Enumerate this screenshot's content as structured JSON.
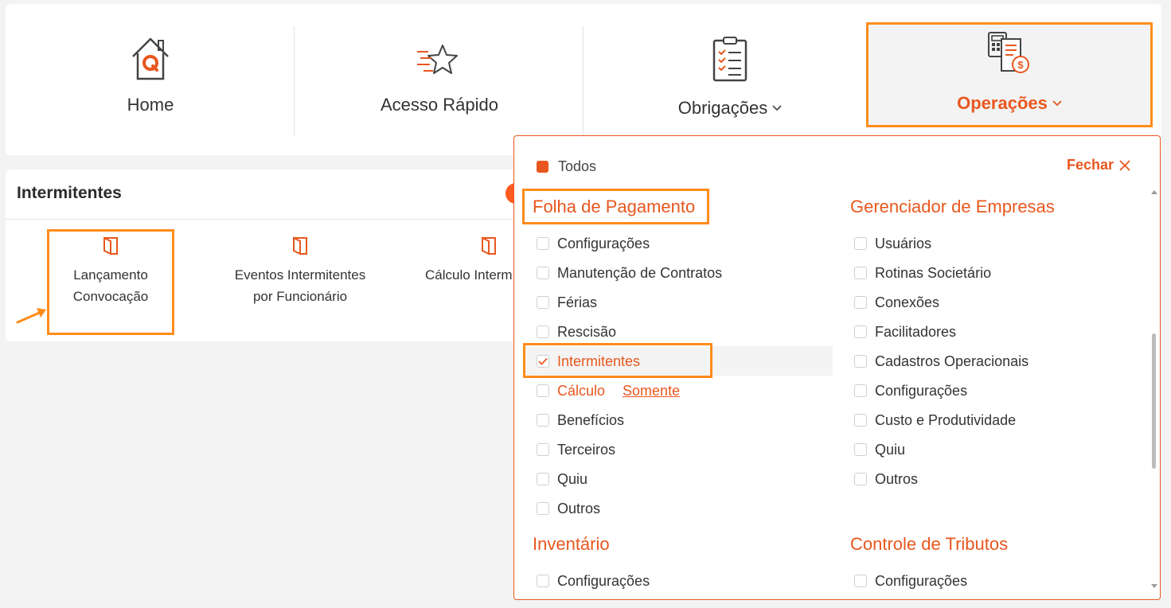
{
  "nav": {
    "home_label": "Home",
    "acesso_label": "Acesso Rápido",
    "obrigacoes_label": "Obrigações",
    "operacoes_label": "Operações",
    "chevron": "⌄"
  },
  "card": {
    "title": "Intermitentes",
    "tiles": [
      {
        "line1": "Lançamento",
        "line2": "Convocação"
      },
      {
        "line1": "Eventos Intermitentes",
        "line2": "por Funcionário"
      },
      {
        "line1": "Cálculo Interm",
        "line2": ""
      }
    ]
  },
  "dropdown": {
    "todos_label": "Todos",
    "fechar_label": "Fechar",
    "sections": {
      "folha": {
        "title": "Folha de Pagamento",
        "items": [
          "Configurações",
          "Manutenção de Contratos",
          "Férias",
          "Rescisão",
          "Intermitentes",
          "Cálculo",
          "Benefícios",
          "Terceiros",
          "Quiu",
          "Outros"
        ],
        "somente_label": "Somente"
      },
      "gerenciador": {
        "title": "Gerenciador de Empresas",
        "items": [
          "Usuários",
          "Rotinas Societário",
          "Conexões",
          "Facilitadores",
          "Cadastros Operacionais",
          "Configurações",
          "Custo e Produtividade",
          "Quiu",
          "Outros"
        ]
      },
      "inventario": {
        "title": "Inventário",
        "items": [
          "Configurações"
        ]
      },
      "controle": {
        "title": "Controle de Tributos",
        "items": [
          "Configurações"
        ]
      }
    }
  },
  "colors": {
    "accent": "#e8571e",
    "highlight": "#ff8c1a"
  }
}
